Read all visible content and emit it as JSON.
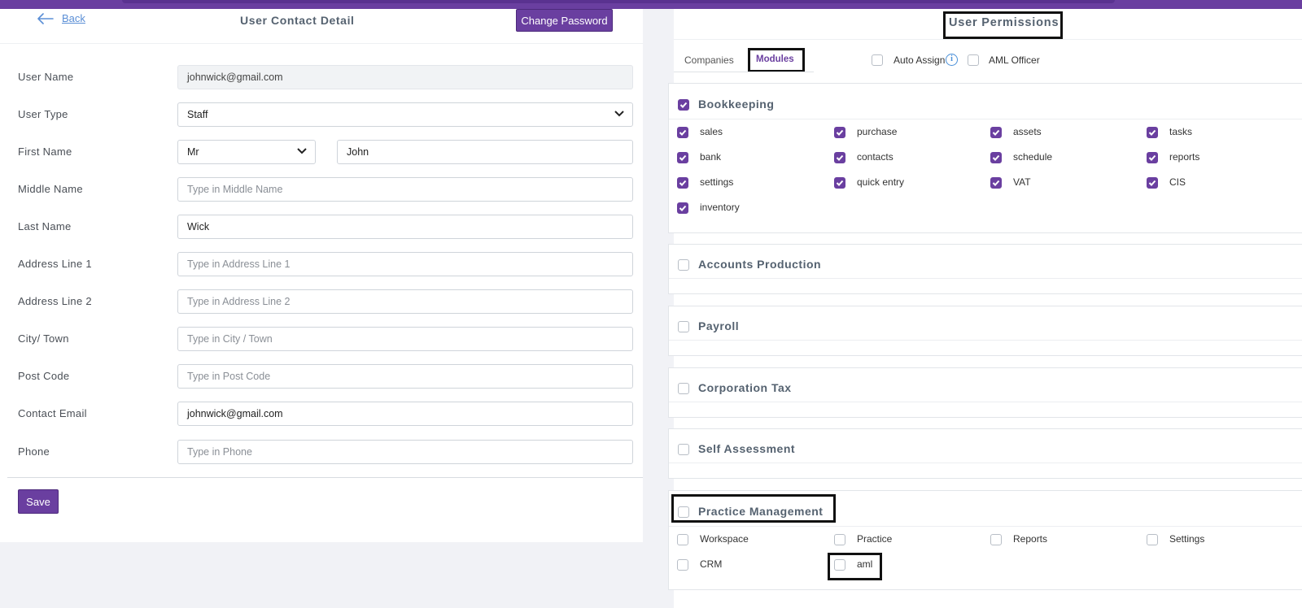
{
  "left": {
    "back_label": "Back",
    "title": "User Contact Detail",
    "change_password_label": "Change Password",
    "save_label": "Save",
    "fields": {
      "user_name": {
        "label": "User Name",
        "value": "johnwick@gmail.com"
      },
      "user_type": {
        "label": "User Type",
        "value": "Staff"
      },
      "first_name": {
        "label": "First Name",
        "title_value": "Mr",
        "value": "John"
      },
      "middle_name": {
        "label": "Middle Name",
        "placeholder": "Type in Middle Name"
      },
      "last_name": {
        "label": "Last Name",
        "value": "Wick"
      },
      "address1": {
        "label": "Address Line 1",
        "placeholder": "Type in Address Line 1"
      },
      "address2": {
        "label": "Address Line 2",
        "placeholder": "Type in Address Line 2"
      },
      "city": {
        "label": "City/ Town",
        "placeholder": "Type in City / Town"
      },
      "postcode": {
        "label": "Post Code",
        "placeholder": "Type in Post Code"
      },
      "contact_email": {
        "label": "Contact Email",
        "value": "johnwick@gmail.com"
      },
      "phone": {
        "label": "Phone",
        "placeholder": "Type in Phone"
      }
    }
  },
  "right": {
    "title": "User Permissions",
    "tabs": {
      "companies": "Companies",
      "modules": "Modules"
    },
    "auto_assign": {
      "label": "Auto Assign",
      "checked": false
    },
    "aml_officer": {
      "label": "AML Officer",
      "checked": false
    },
    "modules": [
      {
        "name": "Bookkeeping",
        "checked": true,
        "items": [
          {
            "label": "sales",
            "checked": true
          },
          {
            "label": "purchase",
            "checked": true
          },
          {
            "label": "assets",
            "checked": true
          },
          {
            "label": "tasks",
            "checked": true
          },
          {
            "label": "bank",
            "checked": true
          },
          {
            "label": "contacts",
            "checked": true
          },
          {
            "label": "schedule",
            "checked": true
          },
          {
            "label": "reports",
            "checked": true
          },
          {
            "label": "settings",
            "checked": true
          },
          {
            "label": "quick entry",
            "checked": true
          },
          {
            "label": "VAT",
            "checked": true
          },
          {
            "label": "CIS",
            "checked": true
          },
          {
            "label": "inventory",
            "checked": true
          }
        ]
      },
      {
        "name": "Accounts Production",
        "checked": false,
        "items": []
      },
      {
        "name": "Payroll",
        "checked": false,
        "items": []
      },
      {
        "name": "Corporation Tax",
        "checked": false,
        "items": []
      },
      {
        "name": "Self Assessment",
        "checked": false,
        "items": []
      },
      {
        "name": "Practice Management",
        "checked": false,
        "items": [
          {
            "label": "Workspace",
            "checked": false
          },
          {
            "label": "Practice",
            "checked": false
          },
          {
            "label": "Reports",
            "checked": false
          },
          {
            "label": "Settings",
            "checked": false
          },
          {
            "label": "CRM",
            "checked": false
          },
          {
            "label": "aml",
            "checked": false
          }
        ]
      }
    ]
  },
  "colors": {
    "accent": "#6a3fa0",
    "link": "#5b8fd6",
    "heading": "#556270"
  }
}
